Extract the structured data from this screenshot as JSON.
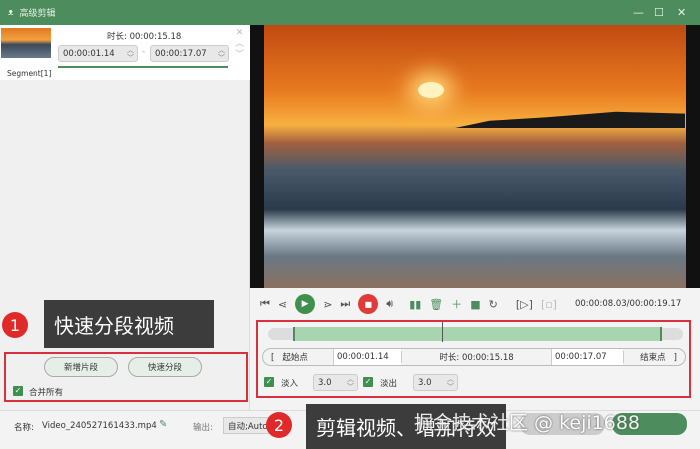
{
  "window": {
    "title": "高级剪辑",
    "minimize": "—",
    "maximize": "☐",
    "close": "✕"
  },
  "segment": {
    "label": "Segment[1]",
    "duration_label": "时长:",
    "duration": "00:00:15.18",
    "start": "00:00:01.14",
    "end": "00:00:17.07",
    "separator": "-"
  },
  "left_actions": {
    "new_segment": "新增片段",
    "quick_split": "快速分段",
    "merge_all": "合并所有",
    "merge_checked": true
  },
  "callouts": [
    {
      "num": "1",
      "text": "快速分段视频"
    },
    {
      "num": "2",
      "text": "剪辑视频、增加特效"
    }
  ],
  "player": {
    "time": "00:00:08.03/00:00:19.17",
    "progress_fraction": 0.42
  },
  "trim": {
    "start_btn": "起始点",
    "start": "00:00:01.14",
    "duration_label": "时长:",
    "duration": "00:00:15.18",
    "end": "00:00:17.07",
    "end_btn": "结束点",
    "range_start_fraction": 0.06,
    "range_end_fraction": 0.95
  },
  "fade": {
    "in_label": "淡入",
    "in_value": "3.0",
    "in_checked": true,
    "out_label": "淡出",
    "out_value": "3.0",
    "out_checked": true
  },
  "bottom": {
    "name_label": "名称:",
    "file_name": "Video_240527161433.mp4",
    "output_label": "输出:",
    "output_value": "自动;Auto"
  },
  "watermark": "掘金技术社区 @ keji1688",
  "colors": {
    "accent": "#4d8c5c",
    "highlight": "#d93040"
  }
}
